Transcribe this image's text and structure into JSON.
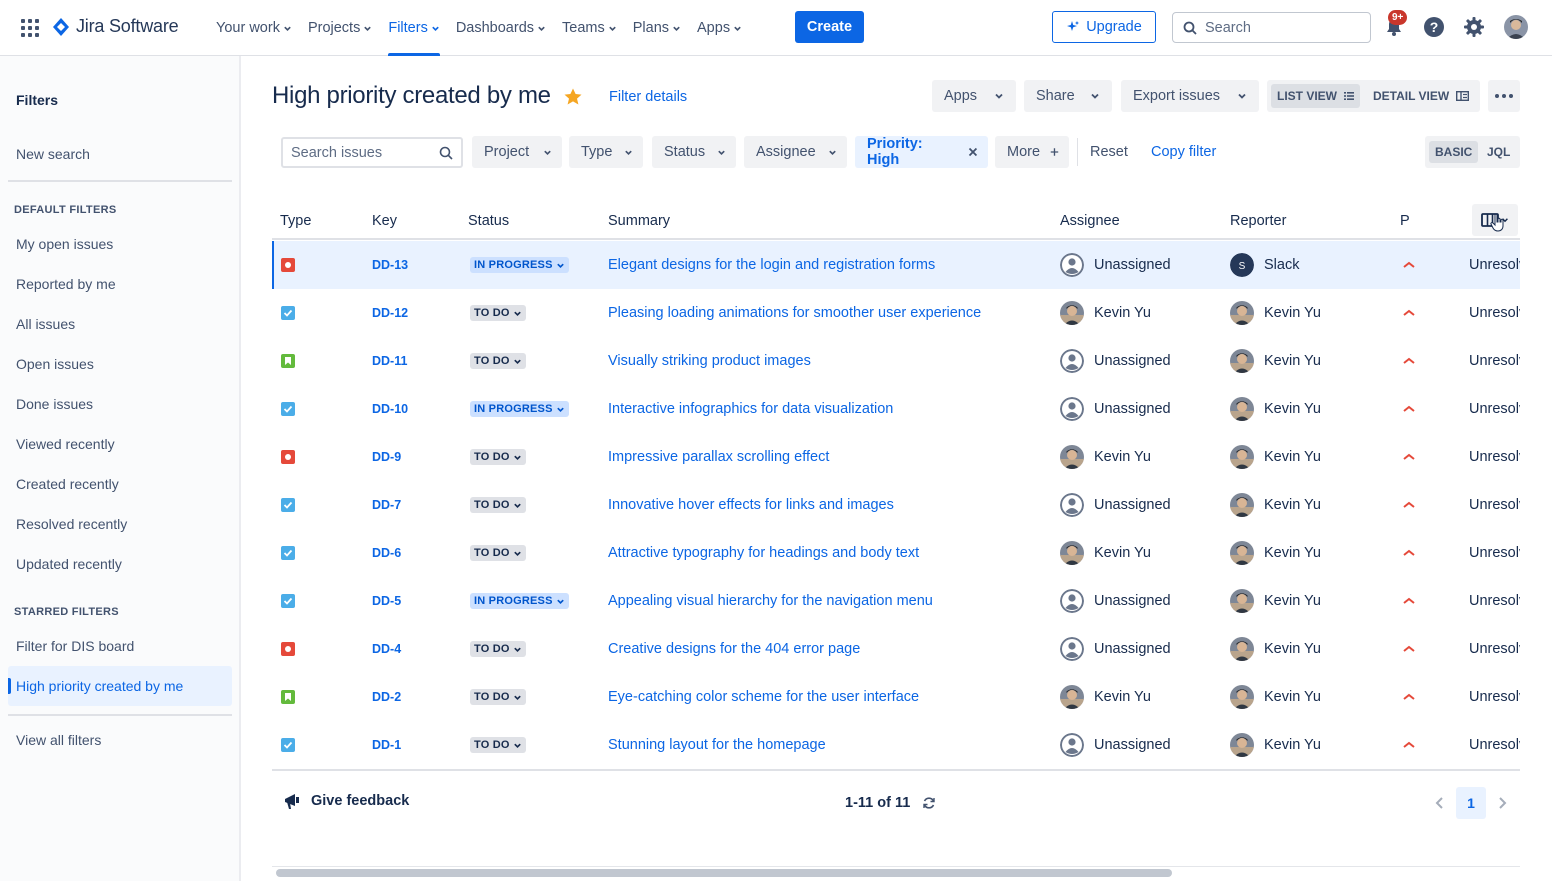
{
  "app": {
    "name": "Jira Software"
  },
  "nav": {
    "items": [
      {
        "label": "Your work",
        "active": false
      },
      {
        "label": "Projects",
        "active": false
      },
      {
        "label": "Filters",
        "active": true
      },
      {
        "label": "Dashboards",
        "active": false
      },
      {
        "label": "Teams",
        "active": false
      },
      {
        "label": "Plans",
        "active": false
      },
      {
        "label": "Apps",
        "active": false
      }
    ],
    "create_label": "Create",
    "upgrade_label": "Upgrade",
    "search_placeholder": "Search",
    "notification_badge": "9+"
  },
  "sidebar": {
    "title": "Filters",
    "new_search": "New search",
    "default_heading": "DEFAULT FILTERS",
    "default_filters": [
      "My open issues",
      "Reported by me",
      "All issues",
      "Open issues",
      "Done issues",
      "Viewed recently",
      "Created recently",
      "Resolved recently",
      "Updated recently"
    ],
    "starred_heading": "STARRED FILTERS",
    "starred_filters": [
      "Filter for DIS board",
      "High priority created by me"
    ],
    "selected": "High priority created by me",
    "view_all": "View all filters"
  },
  "header": {
    "title": "High priority created by me",
    "filter_details": "Filter details",
    "apps_label": "Apps",
    "share_label": "Share",
    "export_label": "Export issues",
    "list_view_label": "LIST VIEW",
    "detail_view_label": "DETAIL VIEW"
  },
  "filters": {
    "search_placeholder": "Search issues",
    "chips": [
      "Project",
      "Type",
      "Status",
      "Assignee"
    ],
    "active_chip": "Priority: High",
    "more_label": "More",
    "reset_label": "Reset",
    "copy_label": "Copy filter",
    "basic_label": "BASIC",
    "jql_label": "JQL"
  },
  "table": {
    "columns": [
      "Type",
      "Key",
      "Status",
      "Summary",
      "Assignee",
      "Reporter",
      "P"
    ],
    "rows": [
      {
        "type": "bug",
        "key": "DD-13",
        "status": "IN PROGRESS",
        "summary": "Elegant designs for the login and registration forms",
        "assignee": "Unassigned",
        "reporter": "Slack",
        "resolution": "Unresolved"
      },
      {
        "type": "task",
        "key": "DD-12",
        "status": "TO DO",
        "summary": "Pleasing loading animations for smoother user experience",
        "assignee": "Kevin Yu",
        "reporter": "Kevin Yu",
        "resolution": "Unresolved"
      },
      {
        "type": "story",
        "key": "DD-11",
        "status": "TO DO",
        "summary": "Visually striking product images",
        "assignee": "Unassigned",
        "reporter": "Kevin Yu",
        "resolution": "Unresolved"
      },
      {
        "type": "task",
        "key": "DD-10",
        "status": "IN PROGRESS",
        "summary": "Interactive infographics for data visualization",
        "assignee": "Unassigned",
        "reporter": "Kevin Yu",
        "resolution": "Unresolved"
      },
      {
        "type": "bug",
        "key": "DD-9",
        "status": "TO DO",
        "summary": "Impressive parallax scrolling effect",
        "assignee": "Kevin Yu",
        "reporter": "Kevin Yu",
        "resolution": "Unresolved"
      },
      {
        "type": "task",
        "key": "DD-7",
        "status": "TO DO",
        "summary": "Innovative hover effects for links and images",
        "assignee": "Unassigned",
        "reporter": "Kevin Yu",
        "resolution": "Unresolved"
      },
      {
        "type": "task",
        "key": "DD-6",
        "status": "TO DO",
        "summary": "Attractive typography for headings and body text",
        "assignee": "Kevin Yu",
        "reporter": "Kevin Yu",
        "resolution": "Unresolved"
      },
      {
        "type": "task",
        "key": "DD-5",
        "status": "IN PROGRESS",
        "summary": "Appealing visual hierarchy for the navigation menu",
        "assignee": "Unassigned",
        "reporter": "Kevin Yu",
        "resolution": "Unresolved"
      },
      {
        "type": "bug",
        "key": "DD-4",
        "status": "TO DO",
        "summary": "Creative designs for the 404 error page",
        "assignee": "Unassigned",
        "reporter": "Kevin Yu",
        "resolution": "Unresolved"
      },
      {
        "type": "story",
        "key": "DD-2",
        "status": "TO DO",
        "summary": "Eye-catching color scheme for the user interface",
        "assignee": "Kevin Yu",
        "reporter": "Kevin Yu",
        "resolution": "Unresolved"
      },
      {
        "type": "task",
        "key": "DD-1",
        "status": "TO DO",
        "summary": "Stunning layout for the homepage",
        "assignee": "Unassigned",
        "reporter": "Kevin Yu",
        "resolution": "Unresolved"
      }
    ],
    "highlighted_row": "DD-13"
  },
  "footer": {
    "feedback_label": "Give feedback",
    "count_text": "1-11 of 11",
    "current_page": "1"
  },
  "colors": {
    "accent": "#0c66e4",
    "bug": "#e5493a",
    "task": "#4bade8",
    "story": "#63ba3c",
    "priority_high": "#e5493a"
  }
}
